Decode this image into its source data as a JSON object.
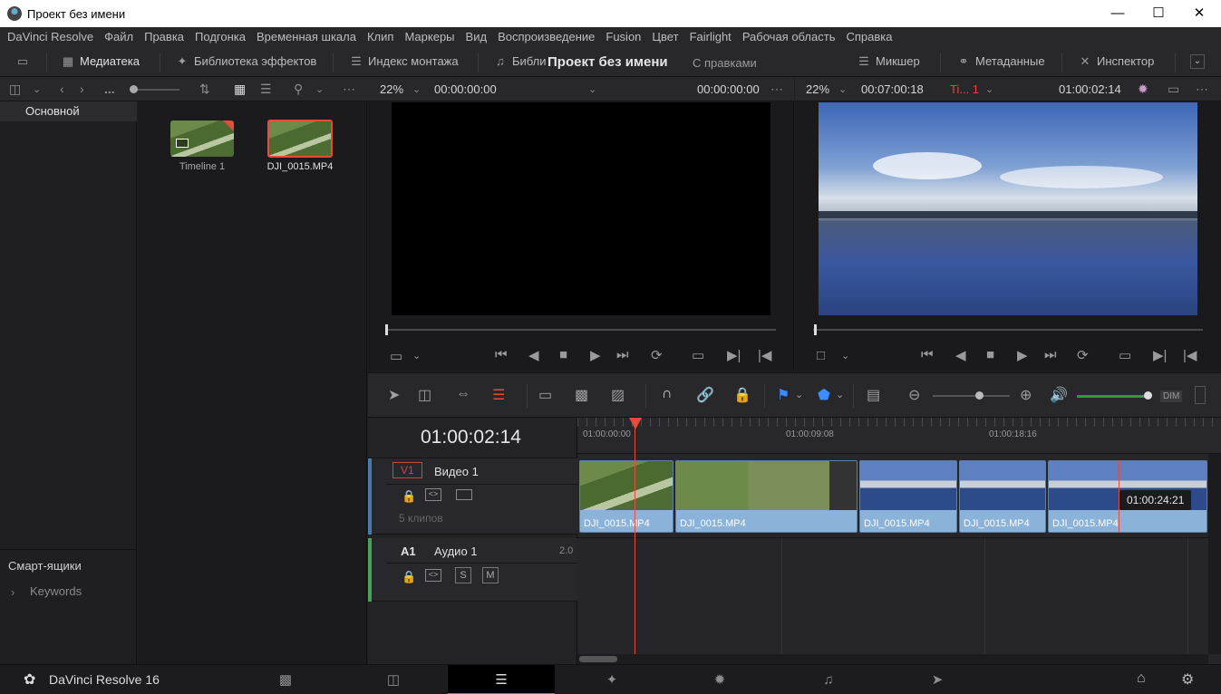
{
  "window": {
    "title": "Проект без имени"
  },
  "menu": [
    "DaVinci Resolve",
    "Файл",
    "Правка",
    "Подгонка",
    "Временная шкала",
    "Клип",
    "Маркеры",
    "Вид",
    "Воспроизведение",
    "Fusion",
    "Цвет",
    "Fairlight",
    "Рабочая область",
    "Справка"
  ],
  "toolbar": {
    "media": "Медиатека",
    "effects": "Библиотека эффектов",
    "edit_index": "Индекс монтажа",
    "sound_lib": "Библиотека звуков",
    "project_title": "Проект без имени",
    "edits": "С правками",
    "mixer": "Микшер",
    "metadata": "Метаданные",
    "inspector": "Инспектор"
  },
  "source_viewer": {
    "zoom": "22%",
    "timecode_left": "00:00:00:00",
    "timecode_right": "00:00:00:00"
  },
  "timeline_viewer": {
    "zoom": "22%",
    "duration": "00:07:00:18",
    "timeline_name": "Ti... 1",
    "timecode": "01:00:02:14"
  },
  "bins": {
    "master": "Основной",
    "smart_bins": "Смарт-ящики",
    "keywords": "Keywords"
  },
  "media_pool": {
    "items": [
      {
        "name": "Timeline 1"
      },
      {
        "name": "DJI_0015.MP4"
      }
    ]
  },
  "timeline": {
    "current_tc": "01:00:02:14",
    "ruler": [
      "01:00:00:00",
      "01:00:09:08",
      "01:00:18:16"
    ],
    "hover_tc": "01:00:24:21",
    "video_track": {
      "id": "V1",
      "name": "Видео 1",
      "clips_count": "5 клипов"
    },
    "audio_track": {
      "id": "A1",
      "name": "Аудио 1",
      "channels": "2.0",
      "solo": "S",
      "mute": "M"
    },
    "clips": [
      "DJI_0015.MP4",
      "DJI_0015.MP4",
      "DJI_0015.MP4",
      "DJI_0015.MP4",
      "DJI_0015.MP4"
    ],
    "dim": "DIM"
  },
  "app": {
    "name": "DaVinci Resolve 16"
  },
  "colors": {
    "accent": "#e64b3c",
    "clip": "#8bb2d9",
    "playhead": "#e64b3c"
  }
}
